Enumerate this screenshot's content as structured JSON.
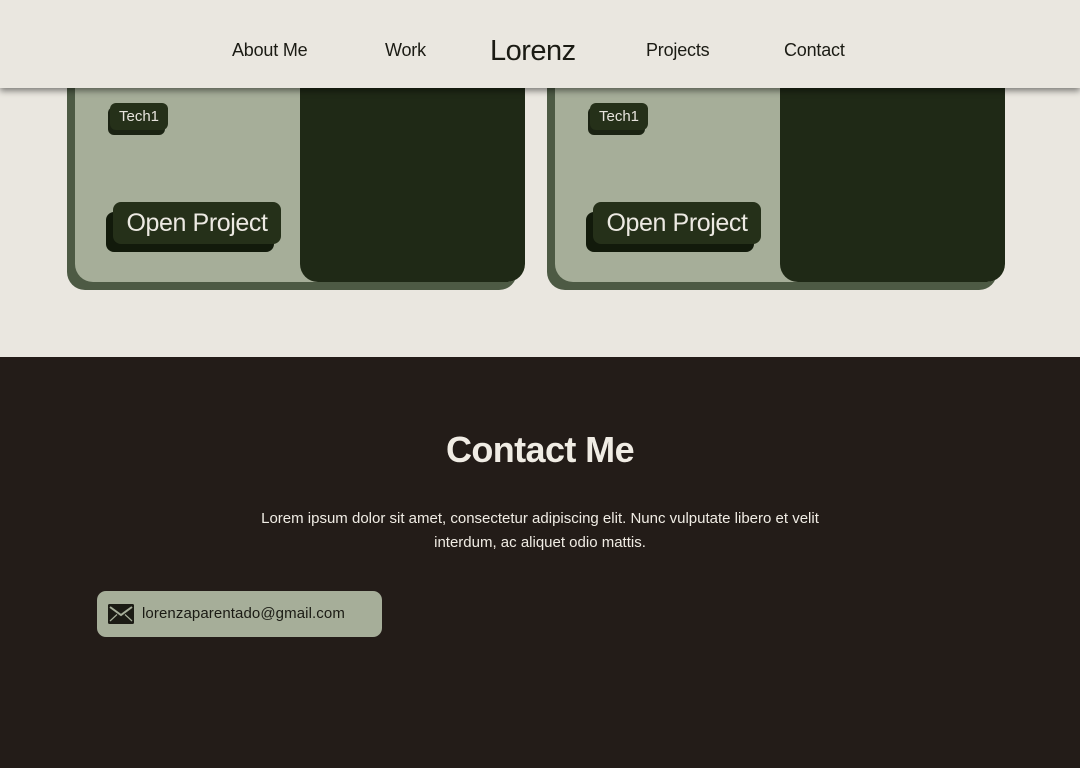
{
  "nav": {
    "about_label": "About Me",
    "work_label": "Work",
    "brand": "Lorenz",
    "projects_label": "Projects",
    "contact_label": "Contact"
  },
  "projects": [
    {
      "tag": "Tech1",
      "button_label": "Open Project"
    },
    {
      "tag": "Tech1",
      "button_label": "Open Project"
    }
  ],
  "contact": {
    "title": "Contact Me",
    "description": "Lorem ipsum dolor sit amet, consectetur adipiscing elit. Nunc vulputate libero et velit interdum, ac aliquet odio mattis.",
    "email": "lorenzaparentado@gmail.com",
    "email_icon": "envelope-icon"
  },
  "colors": {
    "background": "#eae7e0",
    "card": "#a6ae99",
    "card_dark": "#1f2916",
    "footer": "#231c18",
    "text_dark": "#1b1b14",
    "text_light": "#f0ece4"
  }
}
